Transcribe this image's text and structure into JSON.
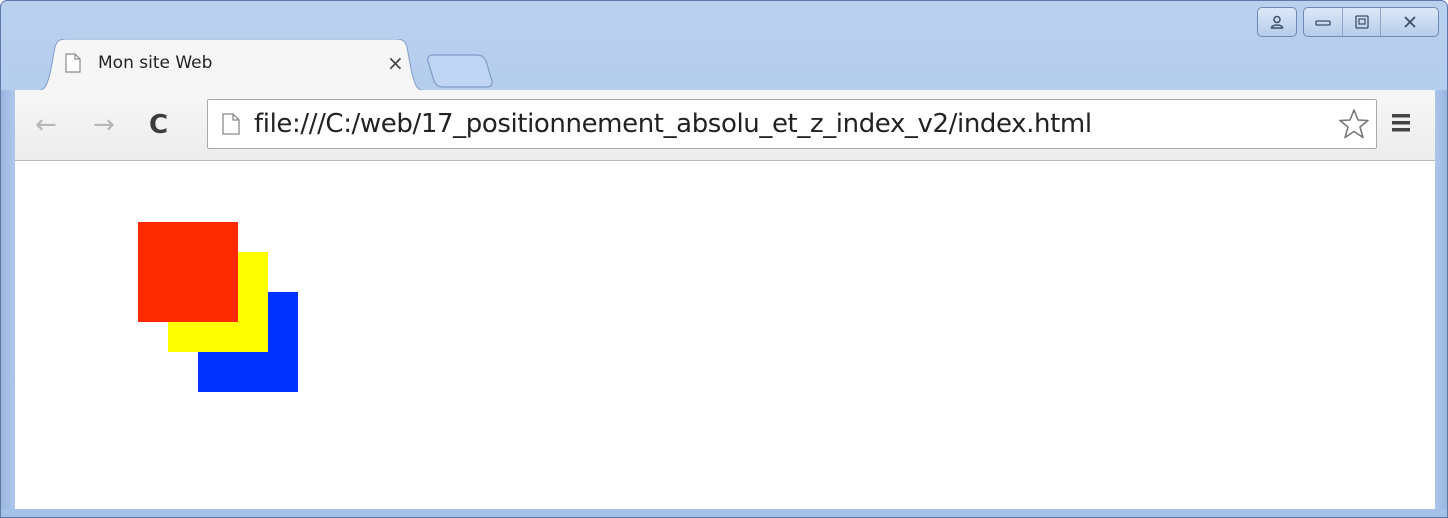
{
  "window": {
    "controls": [
      "user-icon",
      "minimize-icon",
      "maximize-icon",
      "close-icon"
    ]
  },
  "tabs": [
    {
      "title": "Mon site Web",
      "icon": "page-icon",
      "active": true
    }
  ],
  "toolbar": {
    "back_icon": "←",
    "forward_icon": "→",
    "reload_icon": "C",
    "url": "file:///C:/web/17_positionnement_absolu_et_z_index_v2/index.html"
  },
  "content": {
    "boxes": [
      {
        "name": "red",
        "color": "#ff2a00"
      },
      {
        "name": "yellow",
        "color": "#ffff00"
      },
      {
        "name": "blue",
        "color": "#0033ff"
      }
    ]
  }
}
